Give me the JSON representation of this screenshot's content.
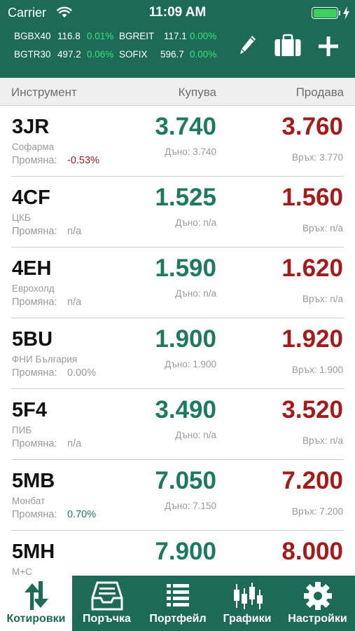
{
  "status_bar": {
    "carrier": "Carrier",
    "time": "11:09 AM"
  },
  "indices": [
    {
      "name": "BGBX40",
      "value": "116.8",
      "change": "0.01%"
    },
    {
      "name": "BGREIT",
      "value": "117.1",
      "change": "0.00%"
    },
    {
      "name": "BGTR30",
      "value": "497.2",
      "change": "0.06%"
    },
    {
      "name": "SOFIX",
      "value": "596.7",
      "change": "0.00%"
    }
  ],
  "header_icons": {
    "edit": "pencil-icon",
    "portfolio": "briefcase-icon",
    "add": "plus-icon"
  },
  "columns": {
    "instrument": "Инструмент",
    "buy": "Купува",
    "sell": "Продава"
  },
  "change_label": "Промяна:",
  "quotes": [
    {
      "symbol": "3JR",
      "company": "Софарма",
      "change": "-0.53%",
      "bid": "3.740",
      "ask": "3.760",
      "low": "Дъно: 3.740",
      "high": "Връх: 3.770"
    },
    {
      "symbol": "4CF",
      "company": "ЦКБ",
      "change": "n/a",
      "bid": "1.525",
      "ask": "1.560",
      "low": "Дъно: n/a",
      "high": "Връх: n/a"
    },
    {
      "symbol": "4EH",
      "company": "Еврохолд",
      "change": "n/a",
      "bid": "1.590",
      "ask": "1.620",
      "low": "Дъно: n/a",
      "high": "Връх: n/a"
    },
    {
      "symbol": "5BU",
      "company": "ФНИ България",
      "change": "0.00%",
      "bid": "1.900",
      "ask": "1.920",
      "low": "Дъно: 1.900",
      "high": "Връх: 1.900"
    },
    {
      "symbol": "5F4",
      "company": "ПИБ",
      "change": "n/a",
      "bid": "3.490",
      "ask": "3.520",
      "low": "Дъно: n/a",
      "high": "Връх: n/a"
    },
    {
      "symbol": "5MB",
      "company": "Монбат",
      "change": "0.70%",
      "bid": "7.050",
      "ask": "7.200",
      "low": "Дъно: 7.150",
      "high": "Връх: 7.200"
    },
    {
      "symbol": "5MH",
      "company": "М+С",
      "change": "",
      "bid": "7.900",
      "ask": "8.000",
      "low": "",
      "high": ""
    }
  ],
  "tabs": [
    {
      "label": "Котировки",
      "icon": "quotes-arrows-icon",
      "active": true
    },
    {
      "label": "Поръчка",
      "icon": "inbox-tray-icon",
      "active": false
    },
    {
      "label": "Портфейл",
      "icon": "list-icon",
      "active": false
    },
    {
      "label": "Графики",
      "icon": "candlestick-icon",
      "active": false
    },
    {
      "label": "Настройки",
      "icon": "gear-icon",
      "active": false
    }
  ],
  "colors": {
    "header_bg": "#1d6b56",
    "positive": "#1d7a5e",
    "negative": "#a31b1b",
    "ticker_positive": "#3be07d"
  }
}
